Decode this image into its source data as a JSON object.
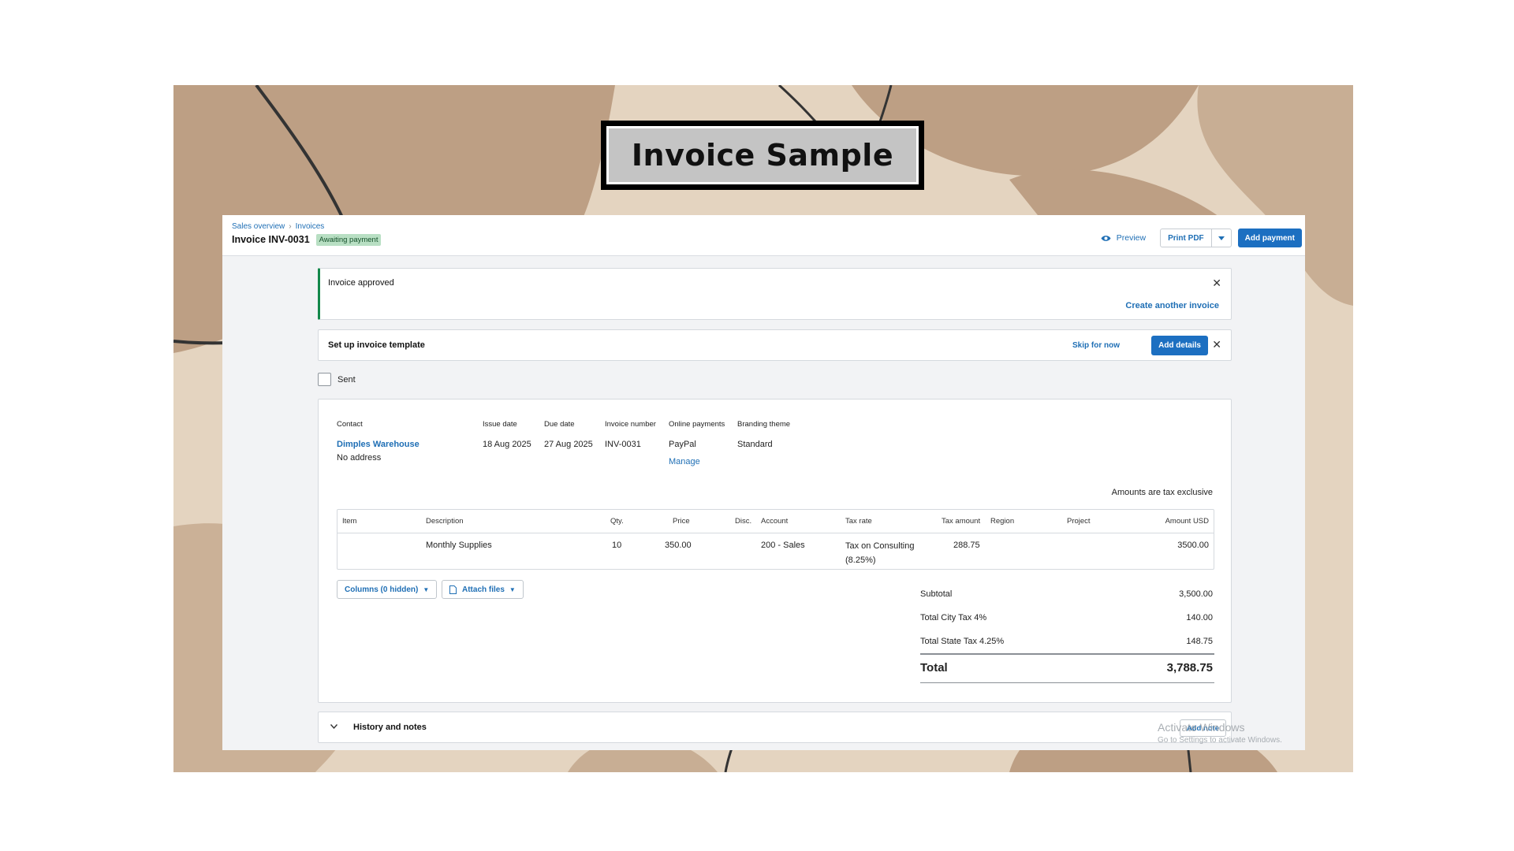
{
  "slide": {
    "title": "Invoice Sample"
  },
  "header": {
    "breadcrumb": [
      "Sales overview",
      "Invoices"
    ],
    "invoice_title": "Invoice INV-0031",
    "status_badge": "Awaiting payment",
    "preview_label": "Preview",
    "print_pdf_label": "Print PDF",
    "add_payment_label": "Add payment"
  },
  "approved_banner": {
    "message": "Invoice approved",
    "create_another_label": "Create another invoice"
  },
  "template_banner": {
    "label": "Set up invoice template",
    "skip_label": "Skip for now",
    "add_details_label": "Add details"
  },
  "sent_checkbox": {
    "label": "Sent",
    "checked": false
  },
  "invoice": {
    "contact_header": "Contact",
    "contact_name": "Dimples Warehouse",
    "contact_address": "No address",
    "issue_date_header": "Issue date",
    "issue_date": "18 Aug 2025",
    "due_date_header": "Due date",
    "due_date": "27 Aug 2025",
    "invoice_number_header": "Invoice number",
    "invoice_number": "INV-0031",
    "online_payments_header": "Online payments",
    "online_payments": "PayPal",
    "manage_label": "Manage",
    "branding_header": "Branding theme",
    "branding": "Standard",
    "tax_mode": "Amounts are tax exclusive"
  },
  "line_items": {
    "columns": {
      "item": "Item",
      "description": "Description",
      "qty": "Qty.",
      "price": "Price",
      "disc": "Disc.",
      "account": "Account",
      "tax_rate": "Tax rate",
      "tax_amount": "Tax amount",
      "region": "Region",
      "project": "Project",
      "amount": "Amount USD"
    },
    "rows": [
      {
        "item": "",
        "description": "Monthly Supplies",
        "qty": "10",
        "price": "350.00",
        "disc": "",
        "account": "200 - Sales",
        "tax_rate": "Tax on Consulting (8.25%)",
        "tax_amount": "288.75",
        "region": "",
        "project": "",
        "amount": "3500.00"
      }
    ]
  },
  "tools": {
    "columns_label": "Columns (0 hidden)",
    "attach_label": "Attach files"
  },
  "totals": {
    "subtotal_label": "Subtotal",
    "subtotal": "3,500.00",
    "city_tax_label": "Total City Tax 4%",
    "city_tax": "140.00",
    "state_tax_label": "Total State Tax 4.25%",
    "state_tax": "148.75",
    "total_label": "Total",
    "total": "3,788.75"
  },
  "history": {
    "label": "History and notes",
    "add_note_label": "Add note"
  },
  "watermark": {
    "line1": "Activate Windows",
    "line2": "Go to Settings to activate Windows."
  },
  "colors": {
    "accent_blue": "#1c6fc1",
    "link_blue": "#1f6fb5",
    "success_green": "#13884a",
    "badge_green": "#b8dfc3",
    "slide_bg": "#e4d4c0",
    "blob_dark": "#bd9f84"
  }
}
